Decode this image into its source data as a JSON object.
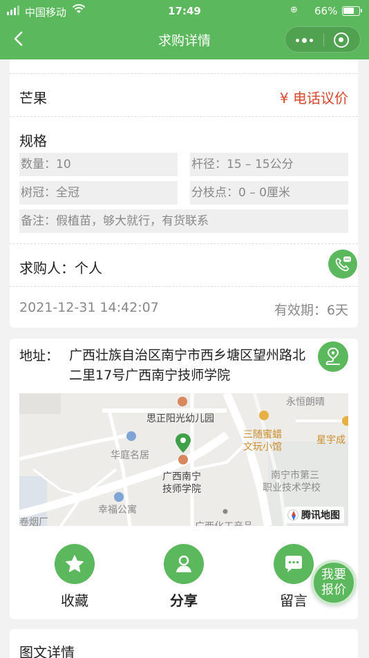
{
  "status_bar": {
    "carrier": "中国移动",
    "time": "17:49",
    "battery": "66%"
  },
  "nav": {
    "title": "求购详情"
  },
  "product": {
    "name": "芒果",
    "price": "¥ 电话议价"
  },
  "specs": {
    "title": "规格",
    "quantity": "数量：10",
    "diameter": "杆径：15 – 15公分",
    "crown": "树冠：全冠",
    "branch_point": "分枝点：0 – 0厘米",
    "remark": "备注：假植苗，够大就行，有货联系"
  },
  "buyer": {
    "text": "求购人：个人"
  },
  "meta": {
    "date": "2021-12-31 14:42:07",
    "validity": "有效期：6天"
  },
  "address": {
    "label": "地址：",
    "text": "广西壮族自治区南宁市西乡塘区望州路北二里17号广西南宁技师学院"
  },
  "map": {
    "labels": {
      "l1": "永恒朗晴",
      "l2": "思正阳光幼儿园",
      "l3": "三随蜜蜡",
      "l4": "文玩小馆",
      "l5": "星宇成",
      "l6": "华庭名居",
      "l7": "广西南宁",
      "l8": "技师学院",
      "l9": "南宁市第三",
      "l10": "职业技术学校",
      "l11": "幸福公寓",
      "l12": "卷烟厂",
      "l13": "广西化工产品"
    },
    "logo": "腾讯地图"
  },
  "actions": {
    "favorite": "收藏",
    "share": "分享",
    "message": "留言"
  },
  "detail": {
    "title": "图文详情"
  },
  "quote": {
    "line1": "我要",
    "line2": "报价"
  }
}
